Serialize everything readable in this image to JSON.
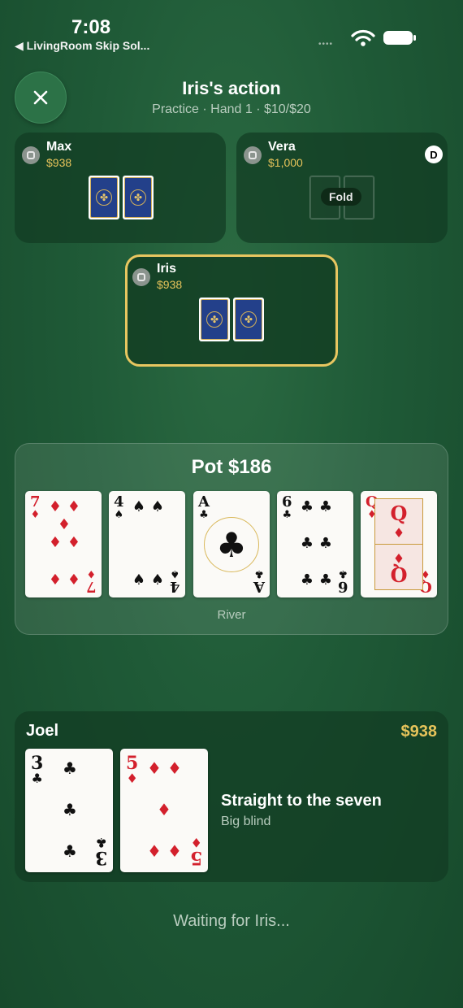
{
  "status_bar": {
    "time": "7:08",
    "back_app": "◀ LivingRoom Skip Sol...",
    "signal_dots": "••••"
  },
  "header": {
    "title": "Iris's action",
    "subtitle": "Practice · Hand 1 · $10/$20"
  },
  "seats": [
    {
      "name": "Max",
      "stack": "$938",
      "state": "cards"
    },
    {
      "name": "Vera",
      "stack": "$1,000",
      "state": "folded",
      "fold_label": "Fold",
      "dealer_label": "D"
    },
    {
      "name": "Iris",
      "stack": "$938",
      "state": "acting"
    }
  ],
  "board": {
    "pot": "Pot $186",
    "street": "River",
    "cards": [
      {
        "rank": "7",
        "suit": "♦",
        "color": "red"
      },
      {
        "rank": "4",
        "suit": "♠",
        "color": "black"
      },
      {
        "rank": "A",
        "suit": "♣",
        "color": "black"
      },
      {
        "rank": "6",
        "suit": "♣",
        "color": "black"
      },
      {
        "rank": "Q",
        "suit": "♦",
        "color": "red"
      }
    ]
  },
  "hero": {
    "name": "Joel",
    "stack": "$938",
    "hand_description": "Straight to the seven",
    "role": "Big blind",
    "cards": [
      {
        "rank": "3",
        "suit": "♣",
        "color": "black"
      },
      {
        "rank": "5",
        "suit": "♦",
        "color": "red"
      }
    ]
  },
  "footer": {
    "waiting_text": "Waiting for Iris..."
  },
  "colors": {
    "felt": "#1f5a37",
    "gold": "#e6c35a",
    "active_border": "#e8c660",
    "red_suit": "#d3202c"
  }
}
